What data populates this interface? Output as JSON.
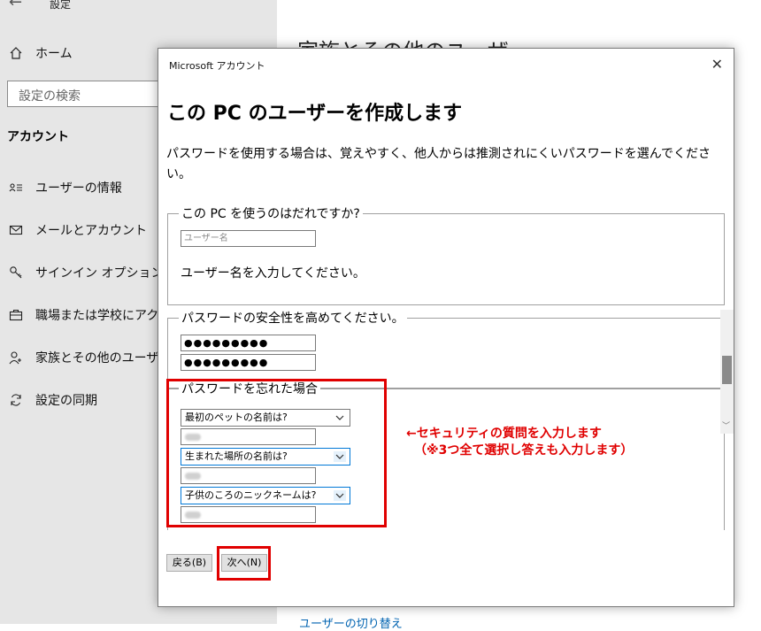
{
  "settings": {
    "title": "設定",
    "home": "ホーム",
    "search_placeholder": "設定の検索",
    "section": "アカウント",
    "nav_items": [
      {
        "label": "ユーザーの情報",
        "icon": "user-info-icon"
      },
      {
        "label": "メールとアカウント",
        "icon": "mail-icon"
      },
      {
        "label": "サインイン オプション",
        "icon": "key-icon"
      },
      {
        "label": "職場または学校にアクセ",
        "icon": "briefcase-icon"
      },
      {
        "label": "家族とその他のユーザー",
        "icon": "person-icon"
      },
      {
        "label": "設定の同期",
        "icon": "sync-icon"
      }
    ],
    "right_heading": "家族とその他のユーザー",
    "right_link": "ユーザーの切り替え"
  },
  "dialog": {
    "title": "Microsoft アカウント",
    "heading": "この PC のユーザーを作成します",
    "description": "パスワードを使用する場合は、覚えやすく、他人からは推測されにくいパスワードを選んでください。",
    "group_user": {
      "legend": "この PC を使うのはだれですか?",
      "username_placeholder": "ユーザー名",
      "hint": "ユーザー名を入力してください。"
    },
    "group_password": {
      "legend": "パスワードの安全性を高めてください。",
      "password_value": "●●●●●●●●●",
      "confirm_value": "●●●●●●●●●"
    },
    "group_forgot": {
      "legend": "パスワードを忘れた場合",
      "questions": [
        "最初のペットの名前は?",
        "生まれた場所の名前は?",
        "子供のころのニックネームは?"
      ]
    },
    "back_button": "戻る(B)",
    "next_button": "次へ(N)"
  },
  "annotation": {
    "line1": "←セキュリティの質問を入力します",
    "line2": "（※3つ全て選択し答えも入力します）",
    "color": "#e00000"
  }
}
